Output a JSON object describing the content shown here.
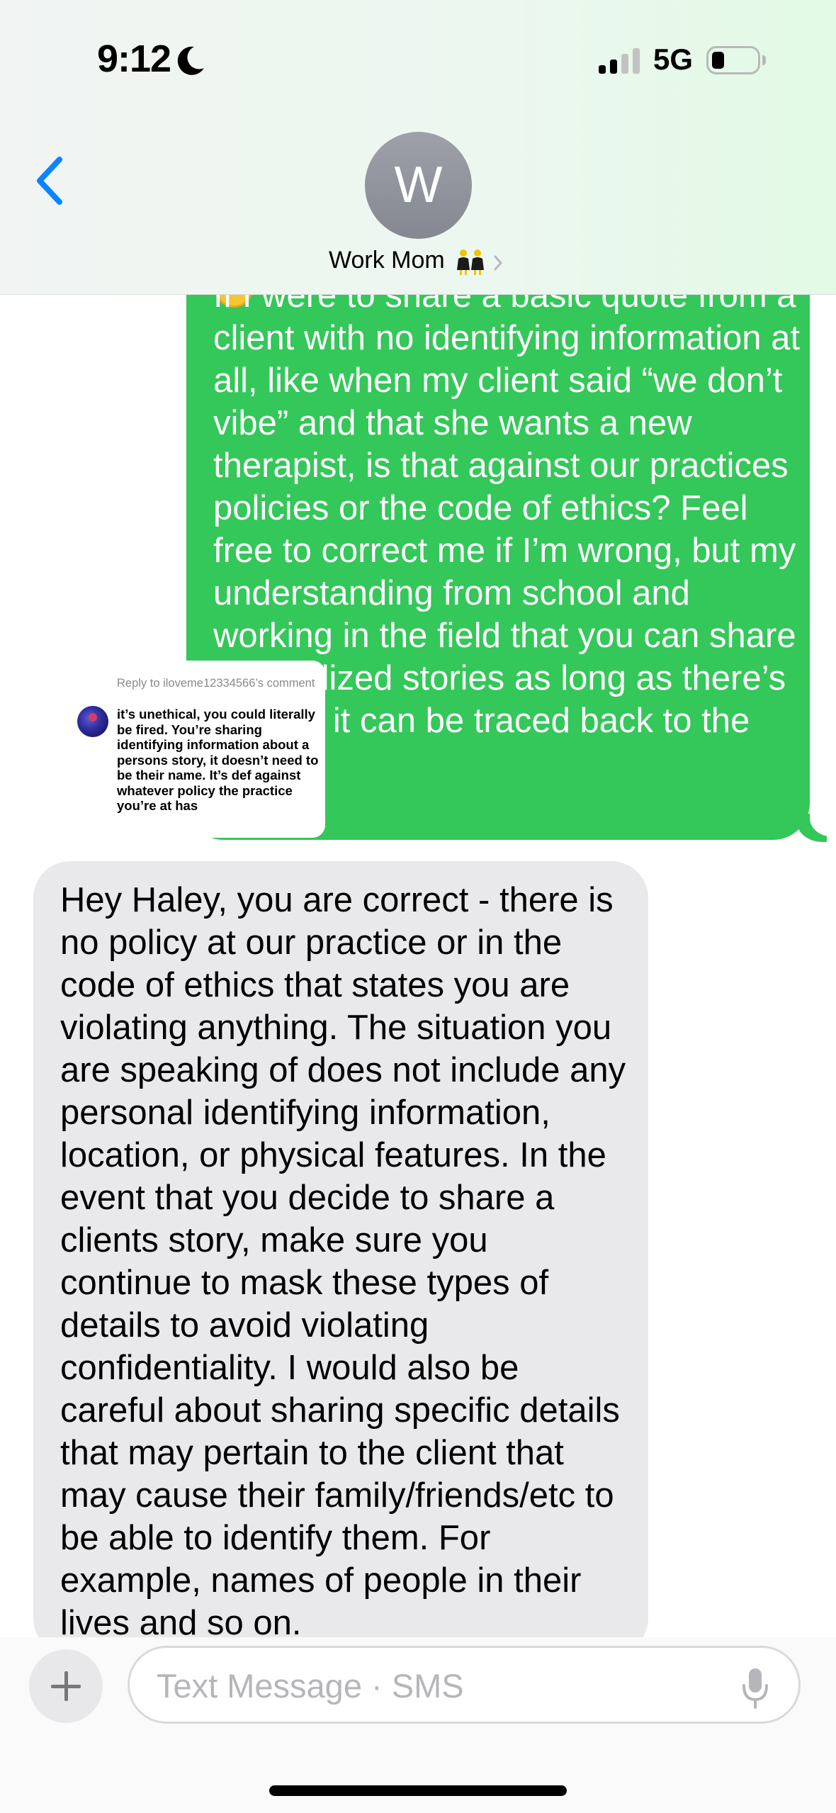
{
  "status_bar": {
    "time": "9:12",
    "network": "5G"
  },
  "header": {
    "avatar_initial": "W",
    "contact_name": "Work Mom"
  },
  "messages": {
    "sent_text": "If I were to share a basic quote from a client with no identifying information at all, like when my client said “we don’t vibe” and that she wants a new therapist, is that against our practices policies or the code of ethics? Feel free to correct me if I’m wrong, but my understanding from school and working in the field that you can share generalized stories as long as there’s no way it can be traced back to the client",
    "received_text": "Hey Haley, you are correct - there is no policy at our practice or in the code of ethics that states you are violating anything. The situation you are speaking of does not include any personal identifying information, location, or physical features. In the event that you decide to share a clients story, make sure you continue to mask these types of details to avoid violating confidentiality. I would also be careful about sharing specific details that may pertain to the client that may cause their family/friends/etc to be able to identify them. For example, names of people in their lives and so on."
  },
  "reply_sticker": {
    "header": "Reply to iloveme12334566’s comment",
    "comment": "it’s unethical, you could literally be fired. You’re sharing identifying information about a persons story, it doesn’t need to be their name. It’s def against whatever policy the practice you’re at has"
  },
  "input": {
    "placeholder": "Text Message · SMS"
  },
  "colors": {
    "sent_bubble": "#34c759",
    "received_bubble": "#e9e9eb",
    "accent": "#0a84ff"
  },
  "icons": {
    "back": "chevron-left-icon",
    "plus": "plus-icon",
    "mic": "microphone-icon",
    "moon": "moon-icon"
  }
}
